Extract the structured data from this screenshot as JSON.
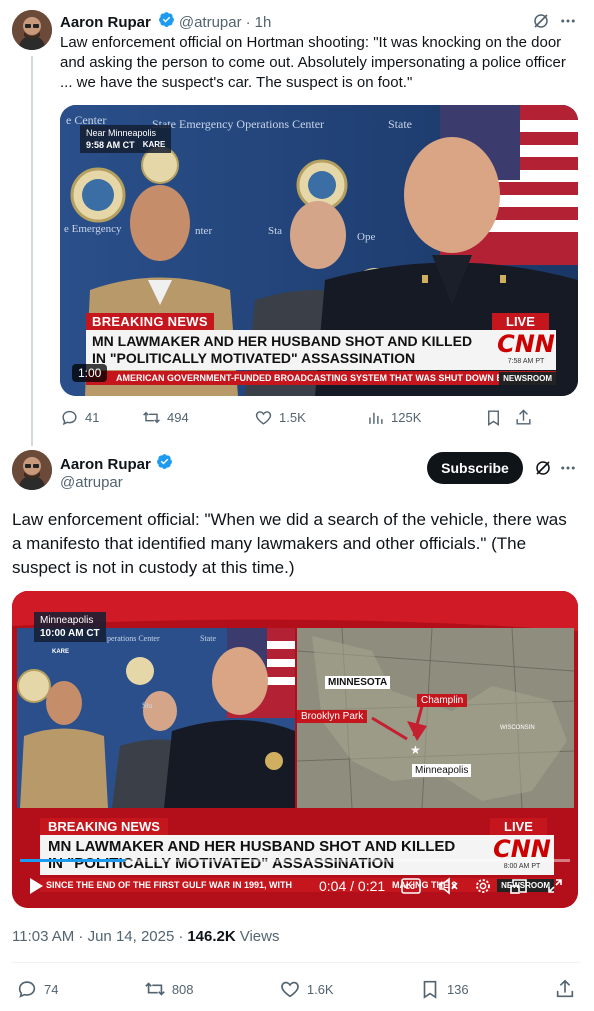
{
  "tweet1": {
    "author_name": "Aaron Rupar",
    "handle": "@atrupar",
    "separator": "·",
    "time": "1h",
    "text": "Law enforcement official on Hortman shooting: \"It was knocking on the door and asking the person to come out. Absolutely impersonating a police officer ... we have the suspect's car. The suspect is on foot.\"",
    "video": {
      "location_tag": "Near Minneapolis",
      "time_tag": "9:58 AM CT",
      "station_tag": "KARE",
      "breaking_label": "BREAKING NEWS",
      "live_label": "LIVE",
      "headline_line1": "MN LAWMAKER AND HER HUSBAND SHOT AND KILLED",
      "headline_line2": "IN \"POLITICALLY MOTIVATED\" ASSASSINATION",
      "logo": "CNN",
      "logo_time": "7:58 AM PT",
      "ticker": "AMERICAN GOVERNMENT-FUNDED BROADCASTING SYSTEM THAT WAS SHUT DOWN B",
      "ticker_tag": "NEWSROOM",
      "duration": "1:00",
      "backdrop_text_1": "e Center",
      "backdrop_text_2": "State Emergency Operations Center",
      "backdrop_text_3": "State",
      "backdrop_text_4": "e Emergency",
      "backdrop_text_5": "nter",
      "backdrop_text_6": "Sta",
      "backdrop_text_7": "Ope"
    },
    "stats": {
      "replies": "41",
      "reposts": "494",
      "likes": "1.5K",
      "views": "125K"
    }
  },
  "tweet2": {
    "author_name": "Aaron Rupar",
    "handle": "@atrupar",
    "subscribe_label": "Subscribe",
    "text": "Law enforcement official: \"When we did a search of the vehicle, there was a manifesto that identified many lawmakers and other officials.\" (The suspect is not in custody at this time.)",
    "video": {
      "location_tag": "Minneapolis",
      "time_tag": "10:00 AM CT",
      "station_tag": "KARE",
      "backdrop_text": "perations Center",
      "backdrop_text_2": "State",
      "backdrop_text_3": "Sta",
      "map_labels": {
        "state": "MINNESOTA",
        "city1": "Champlin",
        "city2": "Brooklyn Park",
        "city3": "Minneapolis",
        "state2": "WISCONSIN"
      },
      "breaking_label": "BREAKING NEWS",
      "live_label": "LIVE",
      "headline_line1": "MN LAWMAKER AND HER HUSBAND SHOT AND KILLED",
      "headline_line2": "IN \"POLITICALLY MOTIVATED\" ASSASSINATION",
      "logo": "CNN",
      "logo_time": "8:00 AM PT",
      "ticker": "SINCE THE END OF THE FIRST GULF WAR IN 1991, WITH",
      "ticker_2": "MAKING THE 2",
      "ticker_tag": "NEWSROOM",
      "current_time": "0:04 / 0:21",
      "progress_fraction": 0.19
    },
    "meta": {
      "timestamp": "11:03 AM · Jun 14, 2025",
      "separator": "·",
      "views_count": "146.2K",
      "views_label": "Views"
    },
    "stats": {
      "replies": "74",
      "reposts": "808",
      "likes": "1.6K",
      "bookmarks": "136"
    }
  },
  "colors": {
    "accent_blue": "#1d9bf0",
    "cnn_red": "#cc0000",
    "chyron_red": "#c4161c",
    "text_primary": "#0f1419",
    "text_secondary": "#536471"
  }
}
